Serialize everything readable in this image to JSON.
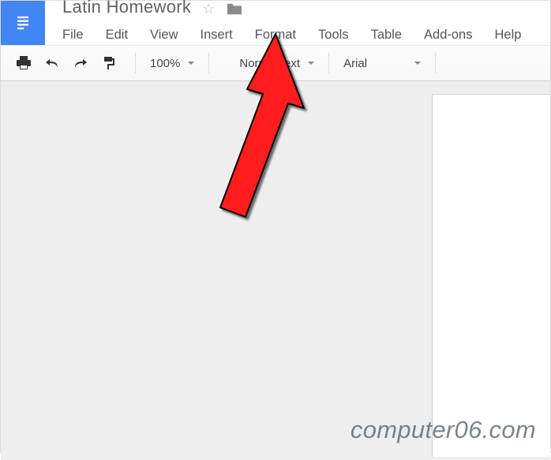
{
  "header": {
    "doc_title": "Latin Homework"
  },
  "menubar": {
    "items": [
      "File",
      "Edit",
      "View",
      "Insert",
      "Format",
      "Tools",
      "Table",
      "Add-ons",
      "Help"
    ]
  },
  "toolbar": {
    "zoom": "100%",
    "style": "Normal text",
    "font": "Arial"
  },
  "watermark": "computer06.com"
}
